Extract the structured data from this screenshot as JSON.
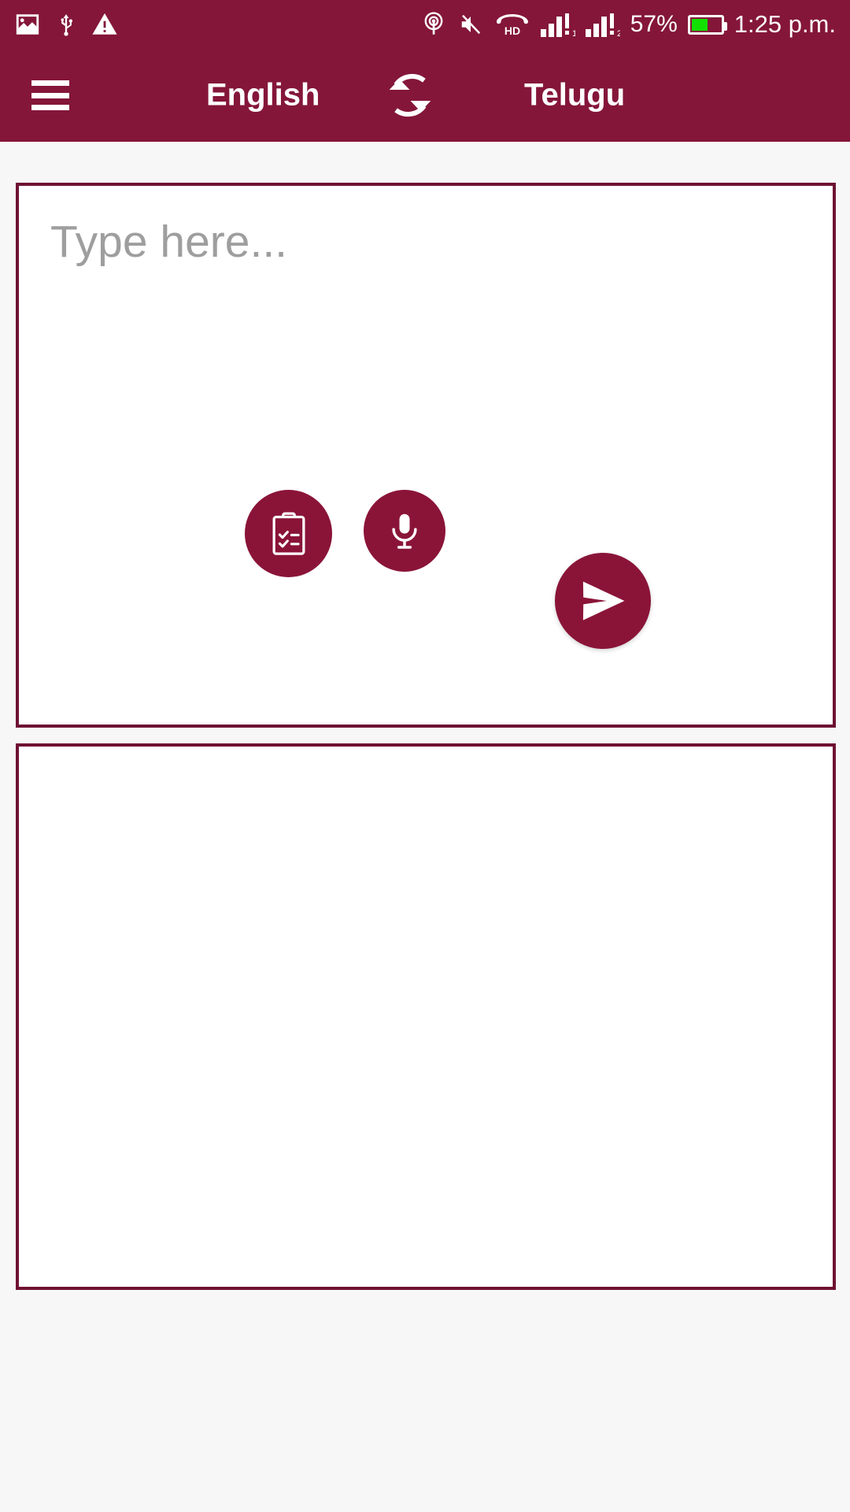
{
  "status_bar": {
    "background_color": "#84163A",
    "left_icons": [
      {
        "name": "image-icon",
        "label": "Screenshot / image"
      },
      {
        "name": "usb-icon",
        "label": "USB connected"
      },
      {
        "name": "warning-icon",
        "label": "Warning"
      }
    ],
    "right_icons": [
      {
        "name": "hotspot-icon",
        "label": "Hotspot"
      },
      {
        "name": "mute-icon",
        "label": "Sound muted"
      },
      {
        "name": "hd-call-icon",
        "label": "HD"
      },
      {
        "name": "signal-sim1-icon",
        "label": "Signal SIM 1"
      },
      {
        "name": "signal-sim2-icon",
        "label": "Signal SIM 2"
      }
    ],
    "hd_label": "HD",
    "battery_percent": "57%",
    "battery_level": 57,
    "battery_color": "#12e000",
    "time": "1:25 p.m."
  },
  "app_bar": {
    "background_color": "#84163A",
    "menu_icon": "hamburger-menu-icon",
    "source_language": "English",
    "target_language": "Telugu",
    "swap_icon": "swap-languages-icon",
    "swap_label": "Swap languages"
  },
  "input_panel": {
    "placeholder": "Type here...",
    "value": "",
    "border_color": "#6E1233",
    "background_color": "#ffffff"
  },
  "output_panel": {
    "value": "",
    "placeholder": "",
    "border_color": "#6E1233",
    "background_color": "#ffffff"
  },
  "actions": {
    "paste": {
      "icon": "clipboard-paste-icon",
      "label": "Paste from clipboard"
    },
    "microphone": {
      "icon": "microphone-icon",
      "label": "Speak"
    },
    "send": {
      "icon": "send-icon",
      "label": "Translate"
    },
    "accent_color": "#8A1438"
  },
  "theme": {
    "primary": "#84163A",
    "border": "#6E1233",
    "accent": "#8A1438",
    "page_background": "#f7f7f7",
    "placeholder_text": "#9e9e9e"
  }
}
